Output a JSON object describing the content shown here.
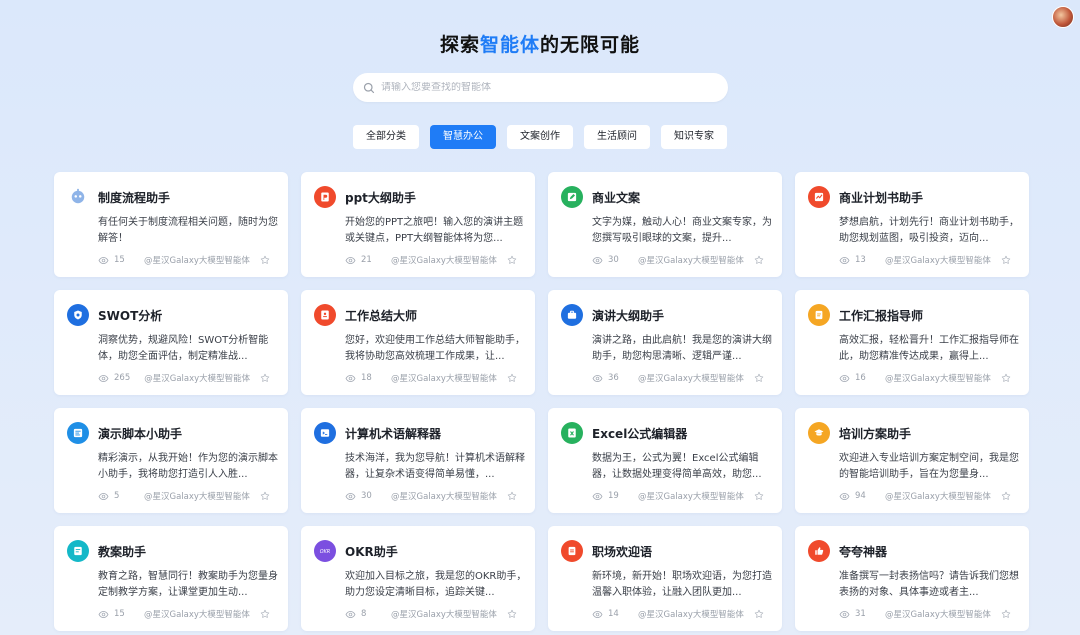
{
  "header": {
    "title_prefix": "探索",
    "title_highlight": "智能体",
    "title_suffix": "的无限可能",
    "accent": "#1f7cf6"
  },
  "search": {
    "placeholder": "请输入您要查找的智能体",
    "value": ""
  },
  "tabs": [
    {
      "label": "全部分类",
      "active": false
    },
    {
      "label": "智慧办公",
      "active": true
    },
    {
      "label": "文案创作",
      "active": false
    },
    {
      "label": "生活顾问",
      "active": false
    },
    {
      "label": "知识专家",
      "active": false
    }
  ],
  "author": "@星汉Galaxy大模型智能体",
  "cards": [
    {
      "title": "制度流程助手",
      "desc": "有任何关于制度流程相关问题，随时为您解答！",
      "views": "15",
      "icon": "robot-icon",
      "color": "#dbe6f5"
    },
    {
      "title": "ppt大纲助手",
      "desc": "开始您的PPT之旅吧！输入您的演讲主题或关键点，PPT大纲智能体将为您...",
      "views": "21",
      "icon": "ppt-icon",
      "color": "#f04a2c"
    },
    {
      "title": "商业文案",
      "desc": "文字为媒，触动人心！商业文案专家，为您撰写吸引眼球的文案，提升...",
      "views": "30",
      "icon": "edit-icon",
      "color": "#27b15e"
    },
    {
      "title": "商业计划书助手",
      "desc": "梦想启航，计划先行！商业计划书助手，助您规划蓝图，吸引投资，迈向...",
      "views": "13",
      "icon": "chart-icon",
      "color": "#f04a2c"
    },
    {
      "title": "SWOT分析",
      "desc": "洞察优势，规避风险！SWOT分析智能体，助您全面评估，制定精准战...",
      "views": "265",
      "icon": "shield-icon",
      "color": "#1f6fe0"
    },
    {
      "title": "工作总结大师",
      "desc": "您好，欢迎使用工作总结大师智能助手，我将协助您高效梳理工作成果，让...",
      "views": "18",
      "icon": "report-icon",
      "color": "#f04a2c"
    },
    {
      "title": "演讲大纲助手",
      "desc": "演讲之路，由此启航！我是您的演讲大纲助手，助您构思清晰、逻辑严谨...",
      "views": "36",
      "icon": "briefcase-icon",
      "color": "#1f6fe0"
    },
    {
      "title": "工作汇报指导师",
      "desc": "高效汇报，轻松晋升！工作汇报指导师在此，助您精准传达成果，赢得上...",
      "views": "16",
      "icon": "clipboard-icon",
      "color": "#f5a623"
    },
    {
      "title": "演示脚本小助手",
      "desc": "精彩演示，从我开始！作为您的演示脚本小助手，我将助您打造引人入胜...",
      "views": "5",
      "icon": "script-icon",
      "color": "#1f8fe6"
    },
    {
      "title": "计算机术语解释器",
      "desc": "技术海洋，我为您导航！计算机术语解释器，让复杂术语变得简单易懂，...",
      "views": "30",
      "icon": "terminal-icon",
      "color": "#1f6fe0"
    },
    {
      "title": "Excel公式编辑器",
      "desc": "数据为王，公式为翼！Excel公式编辑器，让数据处理变得简单高效，助您...",
      "views": "19",
      "icon": "excel-icon",
      "color": "#27b15e"
    },
    {
      "title": "培训方案助手",
      "desc": "欢迎进入专业培训方案定制空间，我是您的智能培训助手，旨在为您量身...",
      "views": "94",
      "icon": "graduation-icon",
      "color": "#f5a623"
    },
    {
      "title": "教案助手",
      "desc": "教育之路，智慧同行！教案助手为您量身定制教学方案，让课堂更加生动...",
      "views": "15",
      "icon": "lesson-icon",
      "color": "#14b8c8"
    },
    {
      "title": "OKR助手",
      "desc": "欢迎加入目标之旅，我是您的OKR助手，助力您设定清晰目标，追踪关键...",
      "views": "8",
      "icon": "okr-icon",
      "color": "#7b4fe0"
    },
    {
      "title": "职场欢迎语",
      "desc": "新环境，新开始！职场欢迎语，为您打造温馨入职体验，让融入团队更加...",
      "views": "14",
      "icon": "document-icon",
      "color": "#f04a2c"
    },
    {
      "title": "夸夸神器",
      "desc": "准备撰写一封表扬信吗？请告诉我们您想表扬的对象、具体事迹或者主...",
      "views": "31",
      "icon": "thumbs-up-icon",
      "color": "#f04a2c"
    }
  ]
}
